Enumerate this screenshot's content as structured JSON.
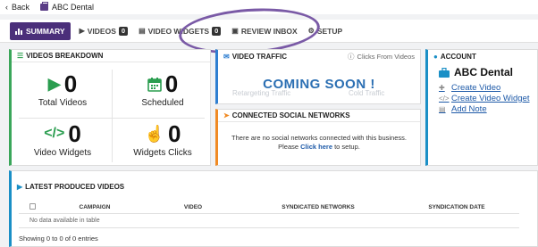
{
  "topbar": {
    "back_label": "Back",
    "business_name": "ABC Dental"
  },
  "tabs": [
    {
      "label": "SUMMARY",
      "icon": "bar-chart-icon"
    },
    {
      "label": "VIDEOS",
      "badge": "0",
      "icon": "play-icon"
    },
    {
      "label": "VIDEO WIDGETS",
      "badge": "0",
      "icon": "widget-icon"
    },
    {
      "label": "REVIEW INBOX",
      "icon": "inbox-icon"
    },
    {
      "label": "SETUP",
      "icon": "gear-icon"
    }
  ],
  "videos_breakdown": {
    "title": "VIDEOS BREAKDOWN",
    "stats": [
      {
        "value": "0",
        "label": "Total Videos",
        "icon": "play-icon"
      },
      {
        "value": "0",
        "label": "Scheduled",
        "icon": "calendar-icon"
      },
      {
        "value": "0",
        "label": "Video Widgets",
        "icon": "code-icon"
      },
      {
        "value": "0",
        "label": "Widgets Clicks",
        "icon": "pointer-icon"
      }
    ]
  },
  "video_traffic": {
    "title": "VIDEO TRAFFIC",
    "filter_label": "Clicks From Videos",
    "overlay": "COMING SOON !",
    "ghost_left": "Retargeting Traffic",
    "ghost_right": "Cold Traffic"
  },
  "social_networks": {
    "title": "CONNECTED SOCIAL NETWORKS",
    "message": "There are no social networks connected with this business.",
    "prompt_prefix": "Please",
    "link": "Click here",
    "prompt_suffix": "to setup."
  },
  "account": {
    "title": "ACCOUNT",
    "business_name": "ABC Dental",
    "links": [
      "Create Video",
      "Create Video Widget",
      "Add Note"
    ]
  },
  "latest": {
    "title": "LATEST PRODUCED VIDEOS",
    "columns": [
      "CAMPAIGN",
      "VIDEO",
      "SYNDICATED NETWORKS",
      "SYNDICATION DATE"
    ],
    "empty": "No data available in table",
    "footer": "Showing 0 to 0 of 0 entries"
  },
  "colors": {
    "accent": "#4b2f7a",
    "green": "#3aa65a",
    "blue": "#2f7fd1",
    "orange": "#f08a24",
    "link": "#1e5aa8"
  }
}
